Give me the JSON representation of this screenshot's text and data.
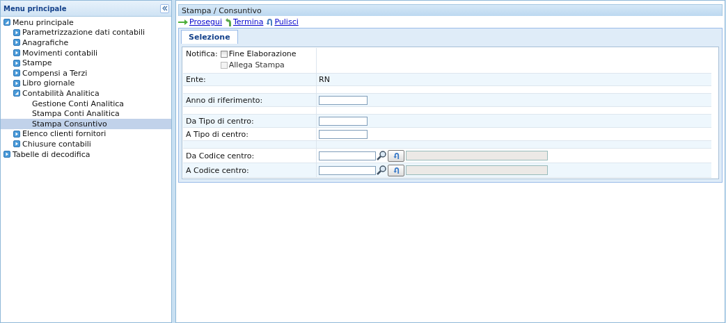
{
  "sidebar": {
    "title": "Menu principale",
    "tree": [
      {
        "label": "Menu principale",
        "expanded": true,
        "selected": false,
        "children": [
          {
            "label": "Parametrizzazione dati contabili",
            "expanded": false,
            "selected": false
          },
          {
            "label": "Anagrafiche",
            "expanded": false,
            "selected": false
          },
          {
            "label": "Movimenti contabili",
            "expanded": false,
            "selected": false
          },
          {
            "label": "Stampe",
            "expanded": false,
            "selected": false
          },
          {
            "label": "Compensi a Terzi",
            "expanded": false,
            "selected": false
          },
          {
            "label": "Libro giornale",
            "expanded": false,
            "selected": false
          },
          {
            "label": "Contabilità Analitica",
            "expanded": true,
            "selected": false,
            "children": [
              {
                "label": "Gestione Conti Analitica",
                "selected": false
              },
              {
                "label": "Stampa Conti Analitica",
                "selected": false
              },
              {
                "label": "Stampa Consuntivo",
                "selected": true
              }
            ]
          },
          {
            "label": "Elenco clienti fornitori",
            "expanded": false,
            "selected": false
          },
          {
            "label": "Chiusure contabili",
            "expanded": false,
            "selected": false
          }
        ]
      },
      {
        "label": "Tabelle di decodifica",
        "expanded": false,
        "selected": false
      }
    ]
  },
  "panel": {
    "title": "Stampa / Consuntivo",
    "actions": [
      {
        "label": "Prosegui",
        "kind": "forward"
      },
      {
        "label": "Termina",
        "kind": "exit"
      },
      {
        "label": "Pulisci",
        "kind": "undo"
      }
    ],
    "tabs": [
      {
        "label": "Selezione",
        "selected": true
      }
    ],
    "rows": [
      {
        "kind": "checks",
        "label": "Notifica:",
        "options": [
          {
            "label": "Fine Elaborazione",
            "checked": false,
            "disabled": false
          },
          {
            "label": "Allega Stampa",
            "checked": false,
            "disabled": true
          }
        ]
      },
      {
        "kind": "text",
        "label": "Ente:",
        "value": "RN"
      },
      {
        "kind": "spacer"
      },
      {
        "kind": "input",
        "label": "Anno di riferimento:"
      },
      {
        "kind": "spacer"
      },
      {
        "kind": "input",
        "label": "Da Tipo di centro:"
      },
      {
        "kind": "input",
        "label": "A Tipo di centro:"
      },
      {
        "kind": "spacer"
      },
      {
        "kind": "lookup",
        "label": "Da Codice centro:"
      },
      {
        "kind": "lookup",
        "label": "A Codice centro:"
      }
    ]
  }
}
